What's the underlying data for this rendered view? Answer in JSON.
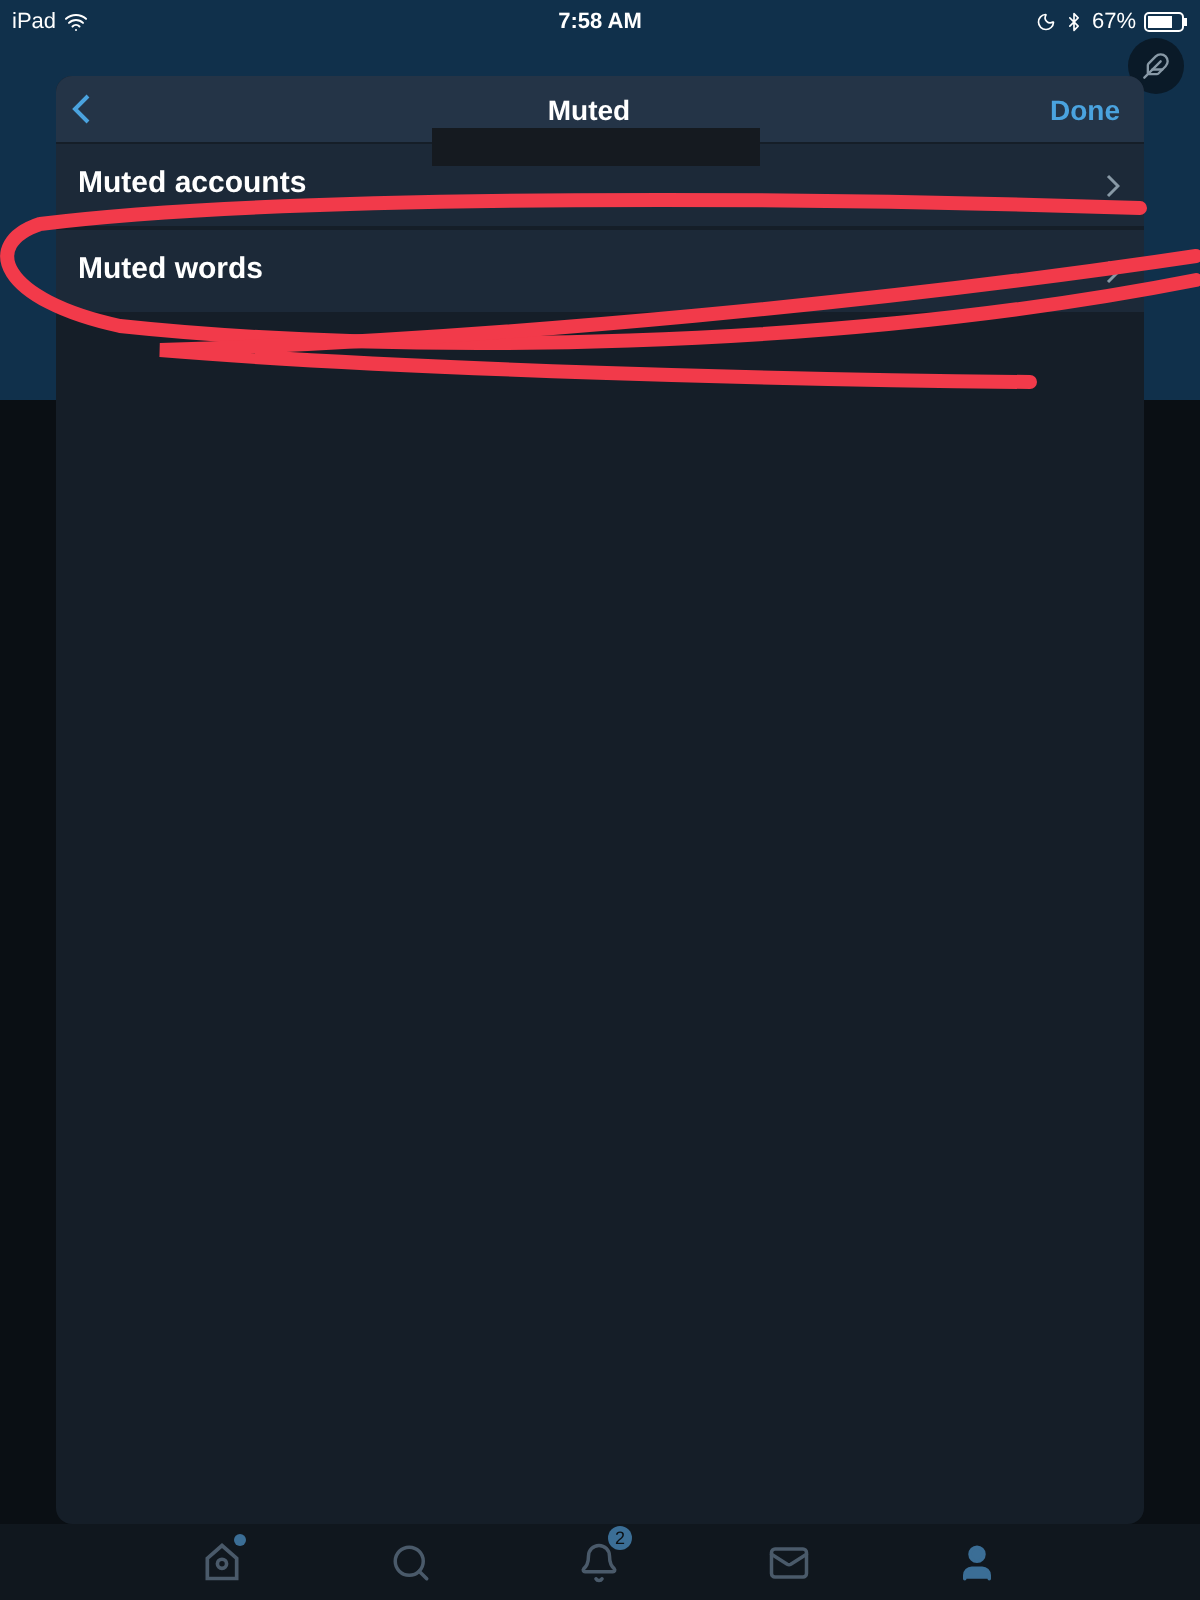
{
  "status_bar": {
    "device": "iPad",
    "time": "7:58 AM",
    "battery": "67%"
  },
  "sheet": {
    "title": "Muted",
    "done": "Done",
    "rows": [
      {
        "label": "Muted accounts"
      },
      {
        "label": "Muted words"
      }
    ]
  },
  "tab_bar": [
    {
      "kind": "home",
      "selected": false,
      "dot": true
    },
    {
      "kind": "search",
      "selected": false
    },
    {
      "kind": "bell",
      "selected": false,
      "badge": "2"
    },
    {
      "kind": "mail",
      "selected": false
    },
    {
      "kind": "person",
      "selected": true
    }
  ]
}
